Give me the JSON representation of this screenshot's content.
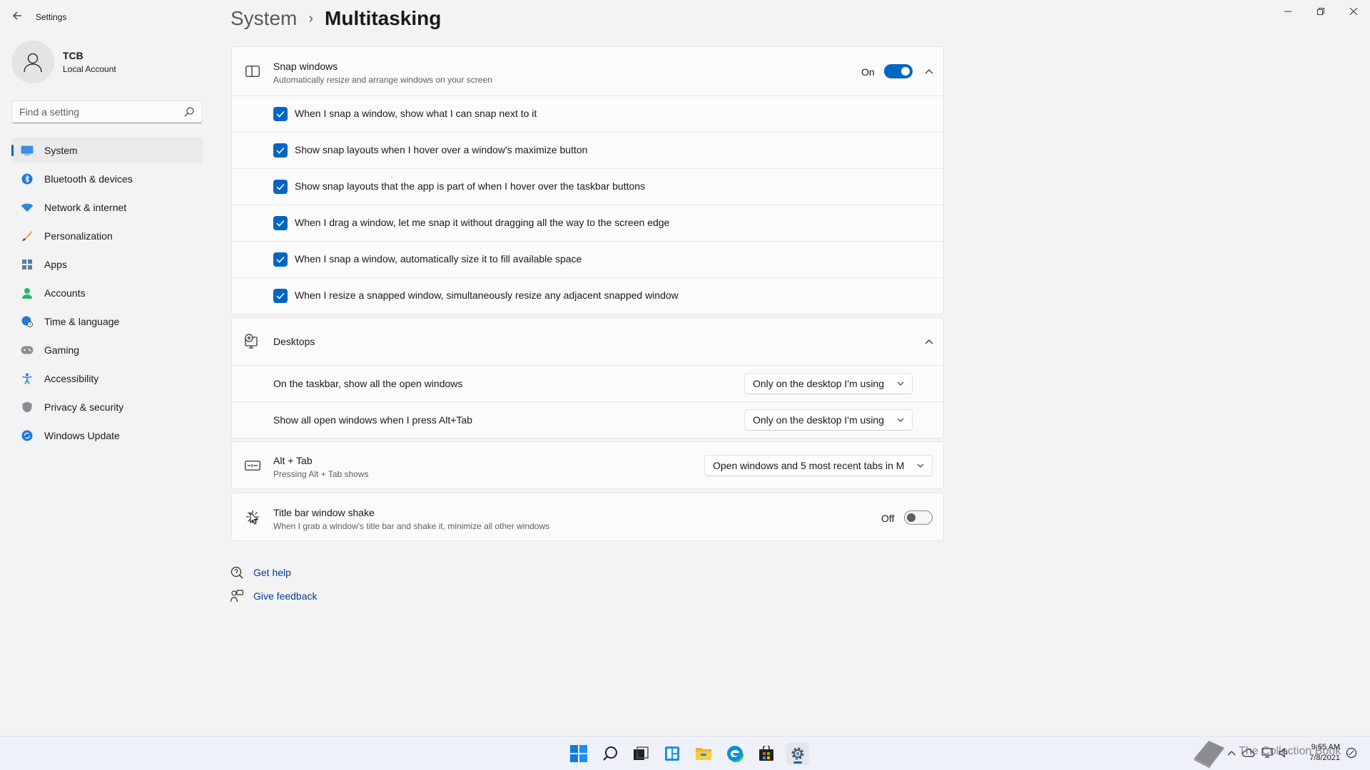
{
  "window": {
    "app_title": "Settings"
  },
  "profile": {
    "name": "TCB",
    "account_type": "Local Account"
  },
  "search": {
    "placeholder": "Find a setting"
  },
  "sidebar": {
    "items": [
      {
        "label": "System",
        "icon": "system-icon",
        "active": true
      },
      {
        "label": "Bluetooth & devices",
        "icon": "bluetooth-icon"
      },
      {
        "label": "Network & internet",
        "icon": "wifi-icon"
      },
      {
        "label": "Personalization",
        "icon": "brush-icon"
      },
      {
        "label": "Apps",
        "icon": "apps-icon"
      },
      {
        "label": "Accounts",
        "icon": "person-icon"
      },
      {
        "label": "Time & language",
        "icon": "globe-clock-icon"
      },
      {
        "label": "Gaming",
        "icon": "controller-icon"
      },
      {
        "label": "Accessibility",
        "icon": "accessibility-icon"
      },
      {
        "label": "Privacy & security",
        "icon": "shield-icon"
      },
      {
        "label": "Windows Update",
        "icon": "update-icon"
      }
    ]
  },
  "breadcrumb": {
    "parent": "System",
    "separator": "›",
    "current": "Multitasking"
  },
  "snap": {
    "title": "Snap windows",
    "description": "Automatically resize and arrange windows on your screen",
    "toggle_state": "On",
    "enabled": true,
    "options": [
      "When I snap a window, show what I can snap next to it",
      "Show snap layouts when I hover over a window's maximize button",
      "Show snap layouts that the app is part of when I hover over the taskbar buttons",
      "When I drag a window, let me snap it without dragging all the way to the screen edge",
      "When I snap a window, automatically size it to fill available space",
      "When I resize a snapped window, simultaneously resize any adjacent snapped window"
    ]
  },
  "desktops": {
    "title": "Desktops",
    "taskbar_label": "On the taskbar, show all the open windows",
    "taskbar_value": "Only on the desktop I'm using",
    "alttab_label": "Show all open windows when I press Alt+Tab",
    "alttab_value": "Only on the desktop I'm using"
  },
  "alt_tab": {
    "title": "Alt + Tab",
    "description": "Pressing Alt + Tab shows",
    "value": "Open windows and 5 most recent tabs in M"
  },
  "shake": {
    "title": "Title bar window shake",
    "description": "When I grab a window's title bar and shake it, minimize all other windows",
    "toggle_state": "Off",
    "enabled": false
  },
  "help": {
    "get_help": "Get help",
    "give_feedback": "Give feedback"
  },
  "taskbar": {
    "time": "9:55 AM",
    "date": "7/8/2021",
    "watermark": "The Collection Book"
  },
  "colors": {
    "accent": "#0067c0",
    "background": "#f3f3f3",
    "card": "#fbfbfb"
  }
}
